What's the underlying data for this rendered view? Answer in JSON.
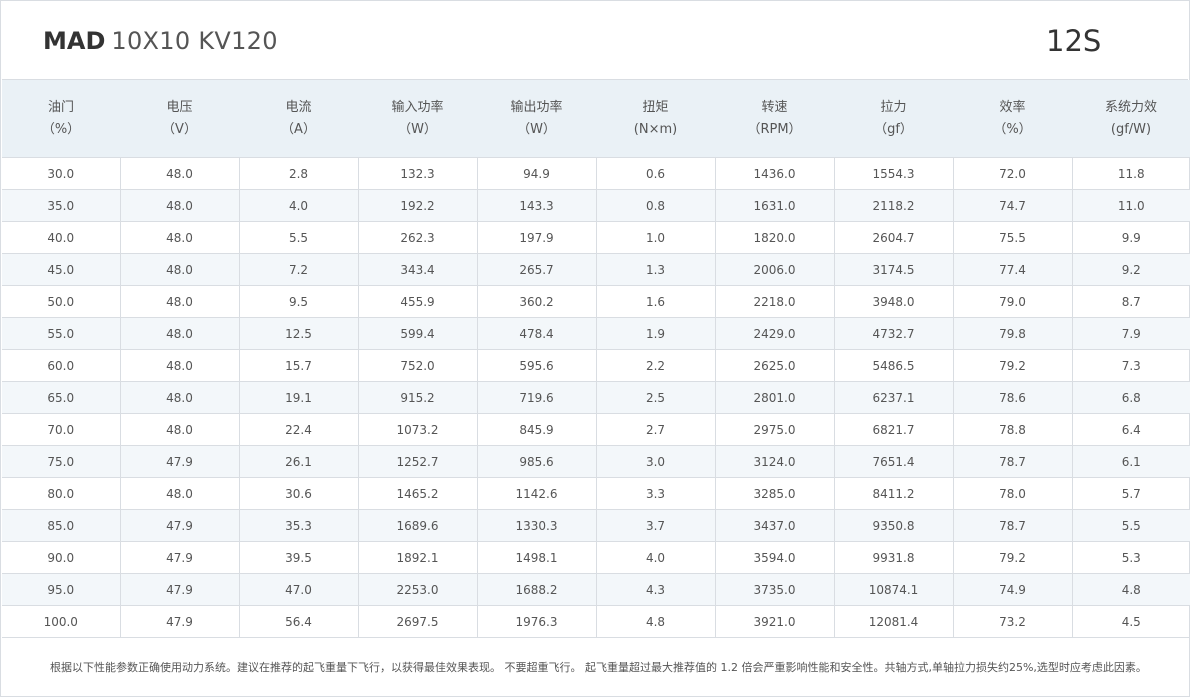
{
  "header": {
    "brand": "MAD",
    "model": "10X10  KV120",
    "cells": "12S"
  },
  "columns": [
    {
      "name": "油门",
      "unit": "（%）"
    },
    {
      "name": "电压",
      "unit": "（V）"
    },
    {
      "name": "电流",
      "unit": "（A）"
    },
    {
      "name": "输入功率",
      "unit": "（W）"
    },
    {
      "name": "输出功率",
      "unit": "（W）"
    },
    {
      "name": "扭矩",
      "unit": "(N×m)"
    },
    {
      "name": "转速",
      "unit": "（RPM）"
    },
    {
      "name": "拉力",
      "unit": "（gf）"
    },
    {
      "name": "效率",
      "unit": "（%）"
    },
    {
      "name": "系统力效",
      "unit": "(gf/W)"
    }
  ],
  "rows": [
    [
      "30.0",
      "48.0",
      "2.8",
      "132.3",
      "94.9",
      "0.6",
      "1436.0",
      "1554.3",
      "72.0",
      "11.8"
    ],
    [
      "35.0",
      "48.0",
      "4.0",
      "192.2",
      "143.3",
      "0.8",
      "1631.0",
      "2118.2",
      "74.7",
      "11.0"
    ],
    [
      "40.0",
      "48.0",
      "5.5",
      "262.3",
      "197.9",
      "1.0",
      "1820.0",
      "2604.7",
      "75.5",
      "9.9"
    ],
    [
      "45.0",
      "48.0",
      "7.2",
      "343.4",
      "265.7",
      "1.3",
      "2006.0",
      "3174.5",
      "77.4",
      "9.2"
    ],
    [
      "50.0",
      "48.0",
      "9.5",
      "455.9",
      "360.2",
      "1.6",
      "2218.0",
      "3948.0",
      "79.0",
      "8.7"
    ],
    [
      "55.0",
      "48.0",
      "12.5",
      "599.4",
      "478.4",
      "1.9",
      "2429.0",
      "4732.7",
      "79.8",
      "7.9"
    ],
    [
      "60.0",
      "48.0",
      "15.7",
      "752.0",
      "595.6",
      "2.2",
      "2625.0",
      "5486.5",
      "79.2",
      "7.3"
    ],
    [
      "65.0",
      "48.0",
      "19.1",
      "915.2",
      "719.6",
      "2.5",
      "2801.0",
      "6237.1",
      "78.6",
      "6.8"
    ],
    [
      "70.0",
      "48.0",
      "22.4",
      "1073.2",
      "845.9",
      "2.7",
      "2975.0",
      "6821.7",
      "78.8",
      "6.4"
    ],
    [
      "75.0",
      "47.9",
      "26.1",
      "1252.7",
      "985.6",
      "3.0",
      "3124.0",
      "7651.4",
      "78.7",
      "6.1"
    ],
    [
      "80.0",
      "48.0",
      "30.6",
      "1465.2",
      "1142.6",
      "3.3",
      "3285.0",
      "8411.2",
      "78.0",
      "5.7"
    ],
    [
      "85.0",
      "47.9",
      "35.3",
      "1689.6",
      "1330.3",
      "3.7",
      "3437.0",
      "9350.8",
      "78.7",
      "5.5"
    ],
    [
      "90.0",
      "47.9",
      "39.5",
      "1892.1",
      "1498.1",
      "4.0",
      "3594.0",
      "9931.8",
      "79.2",
      "5.3"
    ],
    [
      "95.0",
      "47.9",
      "47.0",
      "2253.0",
      "1688.2",
      "4.3",
      "3735.0",
      "10874.1",
      "74.9",
      "4.8"
    ],
    [
      "100.0",
      "47.9",
      "56.4",
      "2697.5",
      "1976.3",
      "4.8",
      "3921.0",
      "12081.4",
      "73.2",
      "4.5"
    ]
  ],
  "footnote": "根据以下性能参数正确使用动力系统。建议在推荐的起飞重量下飞行，以获得最佳效果表现。 不要超重飞行。 起飞重量超过最大推荐值的 1.2 倍会严重影响性能和安全性。共轴方式,单轴拉力损失约25%,选型时应考虑此因素。"
}
